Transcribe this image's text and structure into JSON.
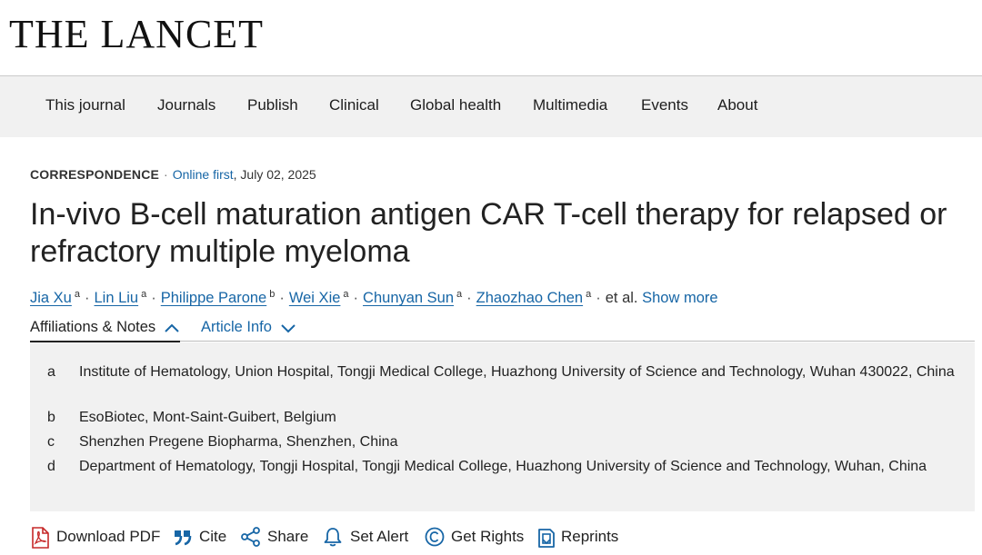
{
  "brand": {
    "logo_text": "THE LANCET"
  },
  "nav": {
    "items": [
      {
        "label": "This journal"
      },
      {
        "label": "Journals"
      },
      {
        "label": "Publish"
      },
      {
        "label": "Clinical"
      },
      {
        "label": "Global health"
      },
      {
        "label": "Multimedia"
      },
      {
        "label": "Events"
      },
      {
        "label": "About"
      }
    ]
  },
  "article": {
    "type": "CORRESPONDENCE",
    "separator": "·",
    "status": "Online first",
    "date": ", July 02, 2025",
    "title": "In-vivo B-cell maturation antigen CAR T-cell therapy for relapsed or refractory multiple myeloma",
    "authors": [
      {
        "name": "Jia Xu",
        "aff": "a"
      },
      {
        "name": "Lin Liu",
        "aff": "a"
      },
      {
        "name": "Philippe Parone",
        "aff": "b"
      },
      {
        "name": "Wei Xie",
        "aff": "a"
      },
      {
        "name": "Chunyan Sun",
        "aff": "a"
      },
      {
        "name": "Zhaozhao Chen",
        "aff": "a"
      }
    ],
    "author_dot": "·",
    "et_al": "et al.",
    "show_more": "Show more"
  },
  "tabs": {
    "affiliations": "Affiliations & Notes",
    "article_info": "Article Info"
  },
  "affiliations": [
    {
      "letter": "a",
      "text": "Institute of Hematology, Union Hospital, Tongji Medical College, Huazhong University of Science and Technology, Wuhan 430022, China"
    },
    {
      "letter": "b",
      "text": "EsoBiotec, Mont-Saint-Guibert, Belgium"
    },
    {
      "letter": "c",
      "text": "Shenzhen Pregene Biopharma, Shenzhen, China"
    },
    {
      "letter": "d",
      "text": "Department of Hematology, Tongji Hospital, Tongji Medical College, Huazhong University of Science and Technology, Wuhan, China"
    }
  ],
  "toolbar": {
    "download_pdf": "Download PDF",
    "cite": "Cite",
    "share": "Share",
    "set_alert": "Set Alert",
    "get_rights": "Get Rights",
    "reprints": "Reprints"
  },
  "colors": {
    "link": "#1766a6",
    "nav_bg": "#f1f1f1",
    "panel_bg": "#f1f1f1",
    "text": "#222222"
  },
  "icons": [
    "pdf-icon",
    "quote-icon",
    "share-icon",
    "bell-icon",
    "copyright-icon",
    "reprints-icon",
    "chevron-up-icon",
    "chevron-down-icon"
  ]
}
